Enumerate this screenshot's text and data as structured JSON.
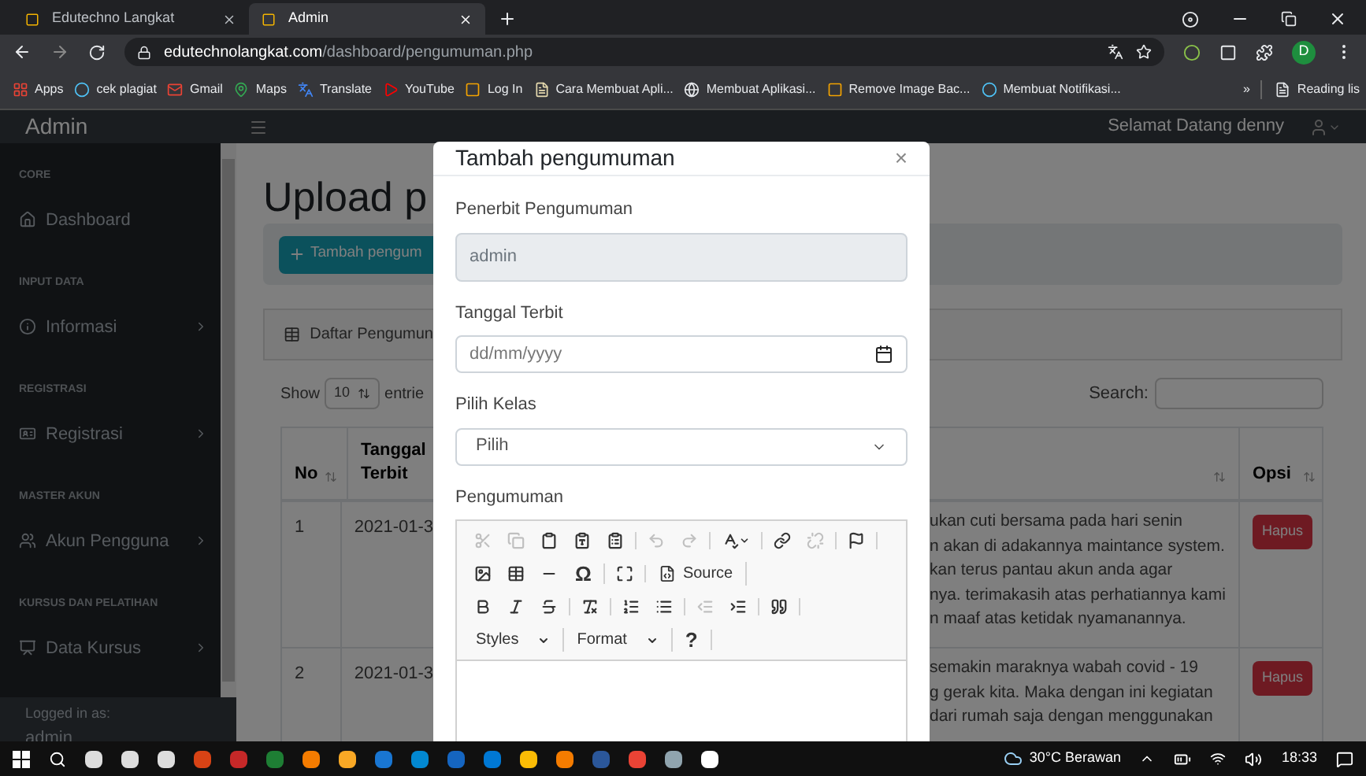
{
  "browser": {
    "tabs": [
      {
        "title": "Edutechno Langkat",
        "selected": false
      },
      {
        "title": "Admin",
        "selected": true
      }
    ],
    "url": {
      "domain": "edutechnolangkat.com",
      "path": "/dashboard/pengumuman.php"
    },
    "profile": "D",
    "bookmarks": [
      {
        "label": "Apps",
        "kind": "apps"
      },
      {
        "label": "cek plagiat",
        "kind": "circle"
      },
      {
        "label": "Gmail",
        "kind": "mail"
      },
      {
        "label": "Maps",
        "kind": "pin"
      },
      {
        "label": "Translate",
        "kind": "translate"
      },
      {
        "label": "YouTube",
        "kind": "play"
      },
      {
        "label": "Log In",
        "kind": "square"
      },
      {
        "label": "Cara Membuat Apli...",
        "kind": "page"
      },
      {
        "label": "Membuat Aplikasi...",
        "kind": "globe"
      },
      {
        "label": "Remove Image Bac...",
        "kind": "square"
      },
      {
        "label": "Membuat Notifikasi...",
        "kind": "circle"
      }
    ],
    "overflow": "»",
    "reading_list": "Reading lis"
  },
  "navbar": {
    "brand": "Admin",
    "greeting": "Selamat Datang denny"
  },
  "sidebar": {
    "sections": [
      {
        "heading": "CORE",
        "items": [
          {
            "label": "Dashboard",
            "kind": "home",
            "expandable": false
          }
        ]
      },
      {
        "heading": "INPUT DATA",
        "items": [
          {
            "label": "Informasi",
            "kind": "info",
            "expandable": true
          }
        ]
      },
      {
        "heading": "REGISTRASI",
        "items": [
          {
            "label": "Registrasi",
            "kind": "card",
            "expandable": true
          }
        ]
      },
      {
        "heading": "MASTER AKUN",
        "items": [
          {
            "label": "Akun Pengguna",
            "kind": "users",
            "expandable": true
          }
        ]
      },
      {
        "heading": "KURSUS DAN PELATIHAN",
        "items": [
          {
            "label": "Data Kursus",
            "kind": "class",
            "expandable": true
          }
        ]
      }
    ],
    "footer": {
      "caption": "Logged in as:",
      "user": "admin"
    }
  },
  "page": {
    "title": "Upload p",
    "add_button": "Tambah pengum",
    "card_title": "Daftar Pengumun",
    "length": {
      "prefix": "Show",
      "value": "10",
      "suffix": "entrie"
    },
    "search_label": "Search:",
    "table": {
      "columns": {
        "no": "No",
        "date": "Tanggal Terbit",
        "options": "Opsi"
      },
      "rows": [
        {
          "no": "1",
          "date": "2021-01-3",
          "column_3": [
            "ukan cuti bersama pada hari senin",
            "n akan di adakannya maintance system.",
            "kan terus pantau akun anda agar",
            "nya. terimakasih atas perhatiannya kami",
            "n maaf atas ketidak nyamanannya."
          ],
          "action": "Hapus"
        },
        {
          "no": "2",
          "date": "2021-01-3",
          "column_3": [
            "semakin maraknya wabah covid - 19",
            "g gerak kita. Maka dengan ini kegiatan",
            "dari rumah saja dengan menggunakan"
          ],
          "action": "Hapus"
        }
      ]
    }
  },
  "modal": {
    "title": "Tambah pengumuman",
    "close": "×",
    "fields": [
      {
        "kind": "readonly",
        "label": "Penerbit Pengumuman",
        "value": "admin"
      },
      {
        "kind": "date",
        "label": "Tanggal Terbit",
        "placeholder": "dd/mm/yyyy"
      },
      {
        "kind": "select",
        "label": "Pilih Kelas",
        "value": "Pilih"
      },
      {
        "kind": "editor",
        "label": "Pengumuman"
      }
    ],
    "toolbar": [
      [
        [
          {
            "kind": "cut",
            "disabled": true
          },
          {
            "kind": "copy",
            "disabled": true
          },
          {
            "kind": "paste",
            "disabled": false
          },
          {
            "kind": "paste-text",
            "disabled": false
          },
          {
            "kind": "paste-word",
            "disabled": false
          }
        ],
        [
          {
            "kind": "undo",
            "disabled": true
          },
          {
            "kind": "redo",
            "disabled": true
          }
        ],
        [
          {
            "kind": "spell",
            "disabled": false
          }
        ],
        [
          {
            "kind": "link",
            "disabled": false
          },
          {
            "kind": "unlink",
            "disabled": true
          }
        ],
        [
          {
            "kind": "flag",
            "disabled": false
          }
        ]
      ],
      [
        [
          {
            "kind": "image",
            "disabled": false
          },
          {
            "kind": "table",
            "disabled": false
          },
          {
            "kind": "rule",
            "disabled": false
          },
          {
            "kind": "glyph",
            "label": "Ω",
            "disabled": false
          }
        ],
        [
          {
            "kind": "maximize",
            "disabled": false
          }
        ],
        [
          {
            "kind": "source",
            "label": "Source",
            "disabled": false
          }
        ]
      ],
      [
        [
          {
            "kind": "bold",
            "disabled": false
          },
          {
            "kind": "italic",
            "disabled": false
          },
          {
            "kind": "strike",
            "disabled": false
          }
        ],
        [
          {
            "kind": "clear",
            "disabled": false
          }
        ],
        [
          {
            "kind": "ol",
            "disabled": false
          },
          {
            "kind": "ul",
            "disabled": false
          }
        ],
        [
          {
            "kind": "outdent",
            "disabled": true
          },
          {
            "kind": "indent",
            "disabled": false
          }
        ],
        [
          {
            "kind": "quote",
            "disabled": false
          }
        ]
      ],
      [
        [
          {
            "kind": "combo",
            "label": "Styles",
            "disabled": false
          }
        ],
        [
          {
            "kind": "combo",
            "label": "Format",
            "disabled": false
          }
        ],
        [
          {
            "kind": "glyph",
            "label": "?",
            "disabled": false
          }
        ]
      ]
    ]
  },
  "taskbar": {
    "weather": "30°C Berawan",
    "time": "18:33"
  }
}
